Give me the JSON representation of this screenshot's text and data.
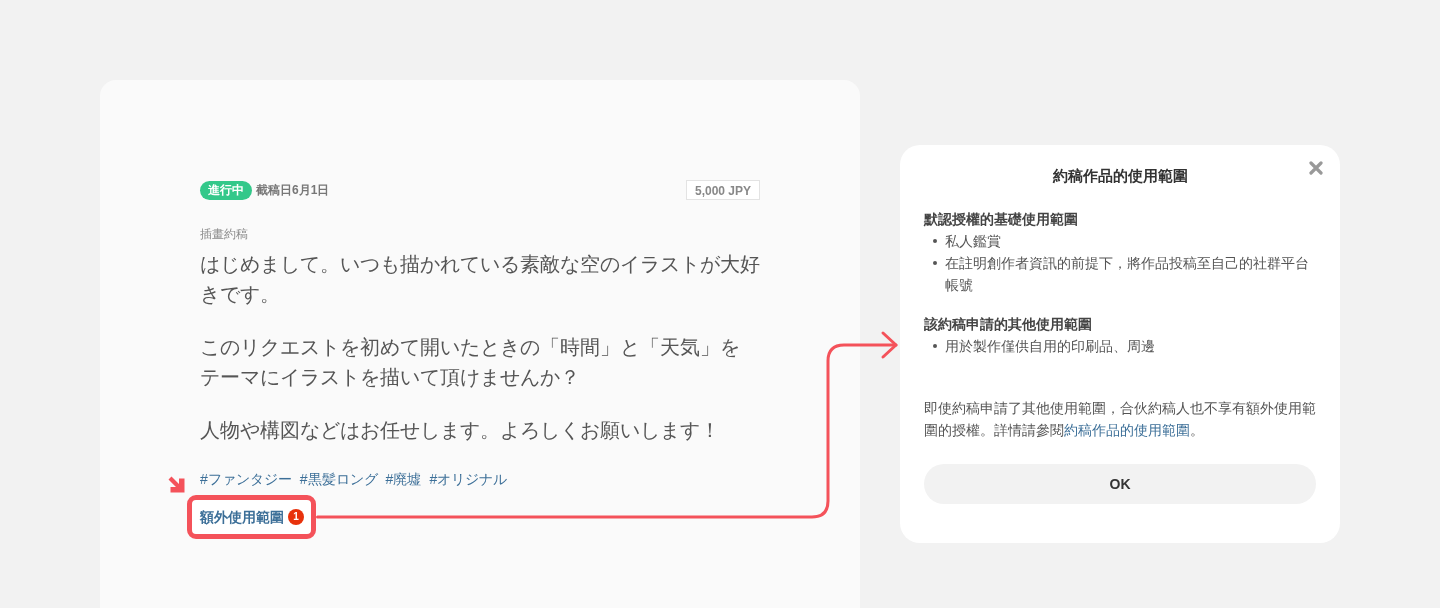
{
  "request_card": {
    "status": {
      "label": "進行中",
      "kind": "in_progress"
    },
    "deadline": "截稿日6月1日",
    "price": "5,000 JPY",
    "category": "插畫約稿",
    "message": [
      "はじめまして。いつも描かれている素敵な空のイラストが大好きです。",
      "このリクエストを初めて開いたときの「時間」と「天気」をテーマにイラストを描いて頂けませんか？",
      "人物や構図などはお任せします。よろしくお願いします！"
    ],
    "tags": [
      "#ファンタジー",
      "#黒髪ロング",
      "#廃墟",
      "#オリジナル"
    ],
    "extra_usage_link": {
      "label": "額外使用範圍",
      "badge": "1"
    }
  },
  "dialog": {
    "title": "約稿作品的使用範圍",
    "sections": [
      {
        "heading": "默認授權的基礎使用範圍",
        "items": [
          "私人鑑賞",
          "在註明創作者資訊的前提下，將作品投稿至自己的社群平台帳號"
        ]
      },
      {
        "heading": "該約稿申請的其他使用範圍",
        "items": [
          "用於製作僅供自用的印刷品、周邊"
        ]
      }
    ],
    "note": {
      "text": "即使約稿申請了其他使用範圍，合伙約稿人也不享有額外使用範圍的授權。詳情請參閱",
      "link": "約稿作品的使用範圍",
      "text_after": "。"
    },
    "button": "OK"
  }
}
